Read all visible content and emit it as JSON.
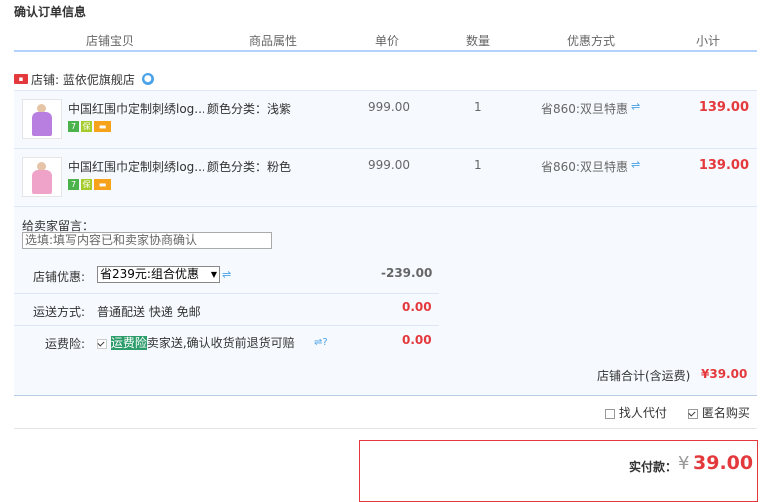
{
  "title": "确认订单信息",
  "columns": [
    "店铺宝贝",
    "商品属性",
    "单价",
    "数量",
    "优惠方式",
    "小计"
  ],
  "store": {
    "label": "店铺: 蓝依伲旗舰店"
  },
  "items": [
    {
      "name": "中国红围巾定制刺绣log...",
      "prop": "颜色分类：浅紫",
      "price": "999.00",
      "qty": "1",
      "promo": "省860:双旦特惠",
      "subtotal": "139.00",
      "color": "#b87fe0"
    },
    {
      "name": "中国红围巾定制刺绣log...",
      "prop": "颜色分类：粉色",
      "price": "999.00",
      "qty": "1",
      "promo": "省860:双旦特惠",
      "subtotal": "139.00",
      "color": "#f0a3c8"
    }
  ],
  "message": {
    "label": "给卖家留言：",
    "placeholder": "选填:填写内容已和卖家协商确认"
  },
  "discount": {
    "label": "店铺优惠:",
    "selected": "省239元:组合优惠",
    "amount": "-239.00"
  },
  "shipping": {
    "label": "运送方式:",
    "value": "普通配送 快递 免邮",
    "amount": "0.00"
  },
  "insurance": {
    "label": "运费险:",
    "tag": "运费险",
    "text": "卖家送,确认收货前退货可赔",
    "amount": "0.00"
  },
  "store_total": {
    "label": "店铺合计(含运费)",
    "amount": "¥39.00"
  },
  "options": {
    "proxy": "找人代付",
    "anonymous": "匿名购买"
  },
  "pay": {
    "label": "实付款：",
    "currency": "¥",
    "amount": "39.00"
  },
  "colors": {
    "accent": "#e4393c",
    "header_line": "#b2d1ff",
    "row_bg": "#f6f9fe"
  }
}
